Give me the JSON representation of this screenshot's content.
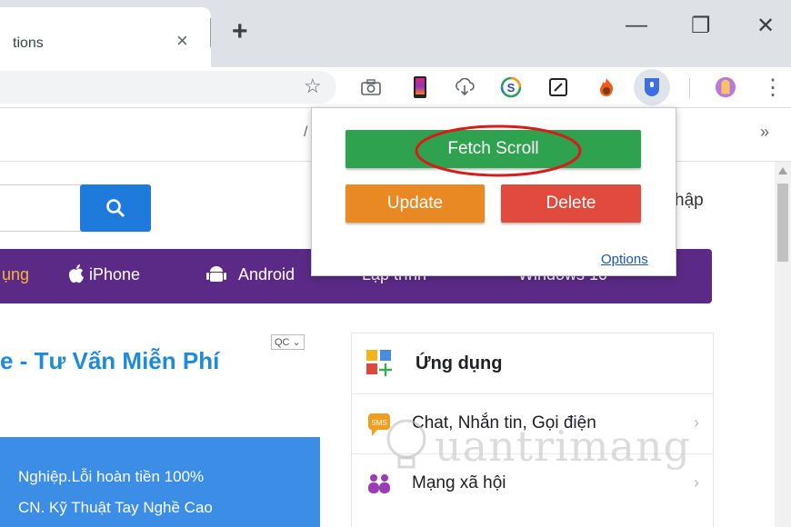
{
  "browser": {
    "tab_title": "tions",
    "close_tab_symbol": "×",
    "new_tab_symbol": "+",
    "window": {
      "minimize": "—",
      "restore": "❐",
      "close": "✕"
    },
    "bookmark_star": "☆",
    "menu_dots": "⋮",
    "bookmarks_overflow": "»",
    "bookmarks_partial": "/"
  },
  "extensions": [
    "camera-icon",
    "phone-gradient-icon",
    "cloud-download-icon",
    "s-circle-icon",
    "pen-box-icon",
    "fire-icon",
    "shield-extension-icon",
    "avatar-icon"
  ],
  "page": {
    "search_icon": "🔍",
    "login_partial": "hập",
    "nav_items": [
      {
        "label": "ụng"
      },
      {
        "label": "iPhone",
        "icon": "apple-icon"
      },
      {
        "label": "Android",
        "icon": "android-icon"
      },
      {
        "label": "Lập trình"
      },
      {
        "label": "Windows 10"
      }
    ],
    "ad_badge": "QC ⌄",
    "ad_title": "e - Tư Vấn Miễn Phí",
    "blue_ad_lines": [
      "Nghiệp.Lỗi hoàn tiền 100%",
      "CN. Kỹ Thuật Tay Nghề Cao"
    ],
    "side_panel": {
      "title": "Ứng dụng",
      "items": [
        {
          "label": "Chat, Nhắn tin, Gọi điện",
          "arrow": "›"
        },
        {
          "label": "Mạng xã hội",
          "arrow": "›"
        }
      ]
    },
    "watermark": "uantrimang"
  },
  "popup": {
    "fetch_label": "Fetch Scroll",
    "update_label": "Update",
    "delete_label": "Delete",
    "options_label": "Options",
    "colors": {
      "fetch": "#2ea24e",
      "update": "#e88924",
      "delete": "#e14b3d",
      "highlight": "#d81b1b"
    }
  }
}
